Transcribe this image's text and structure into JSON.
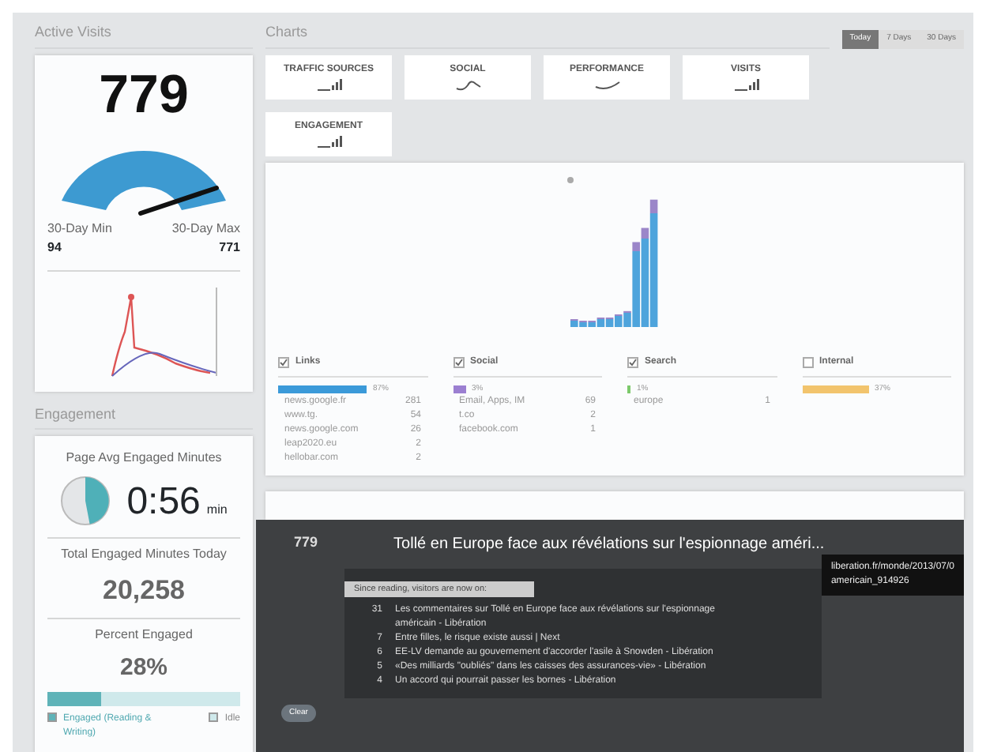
{
  "active_visits": {
    "title": "Active Visits",
    "count": "779",
    "min_label": "30-Day Min",
    "min_value": "94",
    "max_label": "30-Day Max",
    "max_value": "771"
  },
  "engagement": {
    "title": "Engagement",
    "avg_label": "Page Avg Engaged Minutes",
    "avg_value": "0:56",
    "avg_unit": "min",
    "total_label": "Total Engaged Minutes Today",
    "total_value": "20,258",
    "percent_label": "Percent Engaged",
    "percent_value": "28%",
    "percent_bar": {
      "level": 0.28
    },
    "legend": [
      {
        "label": "Engaged (Reading & Writing)",
        "color": "#5fb3b8"
      },
      {
        "label": "Idle",
        "color": "#cfe9eb"
      }
    ]
  },
  "charts": {
    "title": "Charts",
    "ranges": [
      {
        "label": "Today",
        "selected": true
      },
      {
        "label": "7 Days",
        "selected": false
      },
      {
        "label": "30 Days",
        "selected": false
      }
    ],
    "tiles": [
      {
        "label": "TRAFFIC SOURCES",
        "kind": "bars"
      },
      {
        "label": "SOCIAL",
        "kind": "wave"
      },
      {
        "label": "PERFORMANCE",
        "kind": "curve"
      },
      {
        "label": "VISITS",
        "kind": "bars"
      },
      {
        "label": "ENGAGEMENT",
        "kind": "bars"
      }
    ],
    "sources": [
      {
        "name": "Links",
        "checked": true,
        "color": "#3b9ad9",
        "share": "87%",
        "rows": [
          {
            "site": "news.google.fr",
            "count": "281"
          },
          {
            "site": "www.tg.",
            "count": "54"
          },
          {
            "site": "news.google.com",
            "count": "26"
          },
          {
            "site": "leap2020.eu",
            "count": "2"
          },
          {
            "site": "hellobar.com",
            "count": "2"
          }
        ]
      },
      {
        "name": "Social",
        "checked": true,
        "color": "#9b7fd1",
        "share": "3%",
        "rows": [
          {
            "site": "Email, Apps, IM",
            "count": "69"
          },
          {
            "site": "t.co",
            "count": "2"
          },
          {
            "site": "facebook.com",
            "count": "1"
          }
        ]
      },
      {
        "name": "Search",
        "checked": true,
        "color": "#7cc96b",
        "share": "1%",
        "rows": [
          {
            "site": "europe",
            "count": "1"
          }
        ]
      },
      {
        "name": "Internal",
        "checked": false,
        "color": "#f2c46d",
        "share": "37%"
      }
    ]
  },
  "article": {
    "count": "779",
    "title": "Tollé en Europe face aux révélations sur l'espionnage améri...",
    "since_label": "Since reading, visitors are now on:",
    "next": [
      {
        "count": "31",
        "title": "Les commentaires sur Tollé en Europe face aux révélations sur l'espionnage américain - Libération"
      },
      {
        "count": "7",
        "title": "Entre filles, le risque existe aussi | Next"
      },
      {
        "count": "6",
        "title": "EE-LV demande au gouvernement d'accorder l'asile à Snowden - Libération"
      },
      {
        "count": "5",
        "title": "«Des milliards \"oubliés\" dans les caisses des assurances-vie» - Libération"
      },
      {
        "count": "4",
        "title": "Un accord qui pourrait passer les bornes - Libération"
      }
    ],
    "tooltip": [
      "liberation.fr/monde/2013/07/0",
      "americain_914926"
    ],
    "clear_button": "Clear"
  }
}
